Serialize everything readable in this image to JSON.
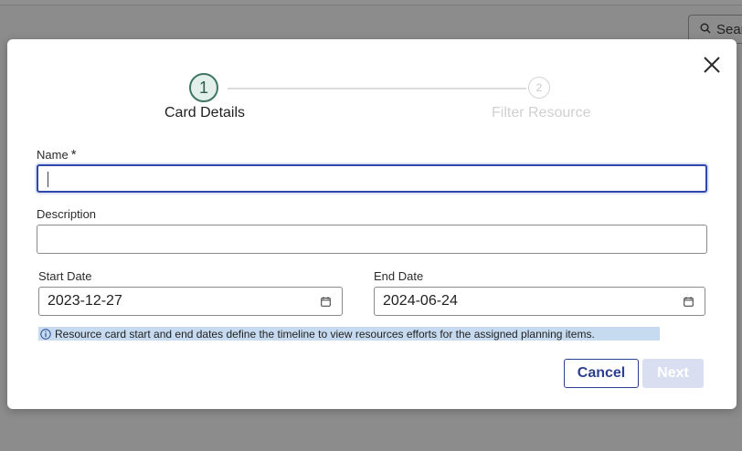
{
  "background": {
    "search_label": "Sear"
  },
  "modal": {
    "stepper": {
      "steps": [
        {
          "number": "1",
          "label": "Card Details",
          "state": "active"
        },
        {
          "number": "2",
          "label": "Filter Resource",
          "state": "inactive"
        }
      ]
    },
    "form": {
      "name": {
        "label": "Name",
        "required_mark": "*",
        "value": ""
      },
      "description": {
        "label": "Description",
        "value": ""
      },
      "start_date": {
        "label": "Start Date",
        "value": "2023-12-27"
      },
      "end_date": {
        "label": "End Date",
        "value": "2024-06-24"
      }
    },
    "info_text": "Resource card start and end dates define the timeline to view resources efforts for the assigned planning items.",
    "buttons": {
      "cancel": "Cancel",
      "next": "Next"
    }
  },
  "colors": {
    "primary": "#2d3f8e",
    "active_step": "#3f7564",
    "info_bg": "#c7dbf0",
    "disabled_button": "#d9def0"
  },
  "icons": [
    "search-icon",
    "close-icon",
    "calendar-icon",
    "info-icon"
  ]
}
